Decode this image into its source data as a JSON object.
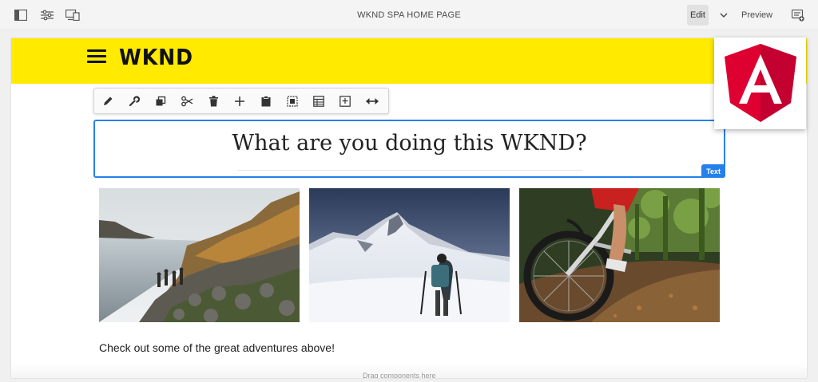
{
  "topbar": {
    "title": "WKND SPA  HOME PAGE",
    "edit_label": "Edit",
    "preview_label": "Preview",
    "icons": [
      "side-panel-icon",
      "page-properties-icon",
      "emulator-icon",
      "annotations-icon",
      "chevron-down-icon"
    ]
  },
  "site": {
    "brand": "WKND",
    "header_color": "#ffea00"
  },
  "component_toolbar": {
    "actions": [
      "edit",
      "configure",
      "copy",
      "cut",
      "delete",
      "insert",
      "paste",
      "group",
      "layout",
      "parent",
      "resize"
    ]
  },
  "text_component": {
    "headline": "What are you doing this WKND?",
    "badge": "Text",
    "selection_color": "#2680eb"
  },
  "gallery": {
    "images": [
      "mountain-lake-hikers",
      "snowy-mountain-climber",
      "mountain-bike-trail"
    ]
  },
  "caption": "Check out some of the great adventures above!",
  "footer_hint": "Drag components here",
  "framework_badge": "angular-logo"
}
